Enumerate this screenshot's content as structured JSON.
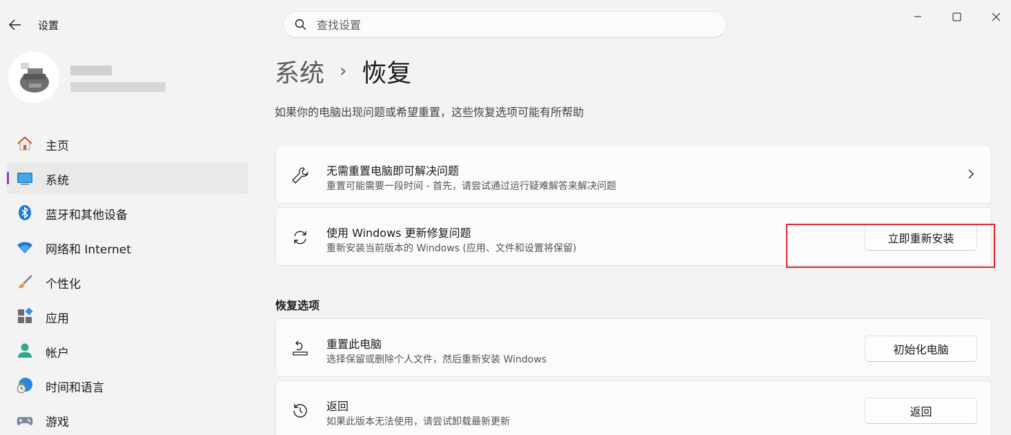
{
  "app": {
    "title": "设置"
  },
  "search": {
    "placeholder": "查找设置"
  },
  "icons": {
    "back": "back-arrow-icon",
    "search": "search-icon",
    "minimize": "minimize-icon",
    "maximize": "maximize-icon",
    "close": "close-icon"
  },
  "sidebar": {
    "items": [
      {
        "label": "主页",
        "icon": "home-icon"
      },
      {
        "label": "系统",
        "icon": "system-icon",
        "active": true
      },
      {
        "label": "蓝牙和其他设备",
        "icon": "bluetooth-icon"
      },
      {
        "label": "网络和 Internet",
        "icon": "wifi-icon"
      },
      {
        "label": "个性化",
        "icon": "brush-icon"
      },
      {
        "label": "应用",
        "icon": "apps-icon"
      },
      {
        "label": "帐户",
        "icon": "account-icon"
      },
      {
        "label": "时间和语言",
        "icon": "globe-clock-icon"
      },
      {
        "label": "游戏",
        "icon": "gamepad-icon"
      }
    ]
  },
  "breadcrumb": {
    "parent": "系统",
    "separator": "›",
    "current": "恢复"
  },
  "subtitle": "如果你的电脑出现问题或希望重置，这些恢复选项可能有所帮助",
  "cards": {
    "troubleshoot": {
      "title": "无需重置电脑即可解决问题",
      "desc": "重置可能需要一段时间 - 首先，请尝试通过运行疑难解答来解决问题"
    },
    "windows_update": {
      "title": "使用 Windows 更新修复问题",
      "desc": "重新安装当前版本的 Windows (应用、文件和设置将保留)",
      "button": "立即重新安装"
    }
  },
  "recovery_section": {
    "title": "恢复选项",
    "reset": {
      "title": "重置此电脑",
      "desc": "选择保留或删除个人文件，然后重新安装 Windows",
      "button": "初始化电脑"
    },
    "goback": {
      "title": "返回",
      "desc": "如果此版本无法使用，请尝试卸载最新更新",
      "button": "返回"
    }
  },
  "colors": {
    "accent": "#8b3fb8",
    "highlight": "#e0252b",
    "background": "#f3f3f3",
    "card": "#fbfbfb"
  }
}
